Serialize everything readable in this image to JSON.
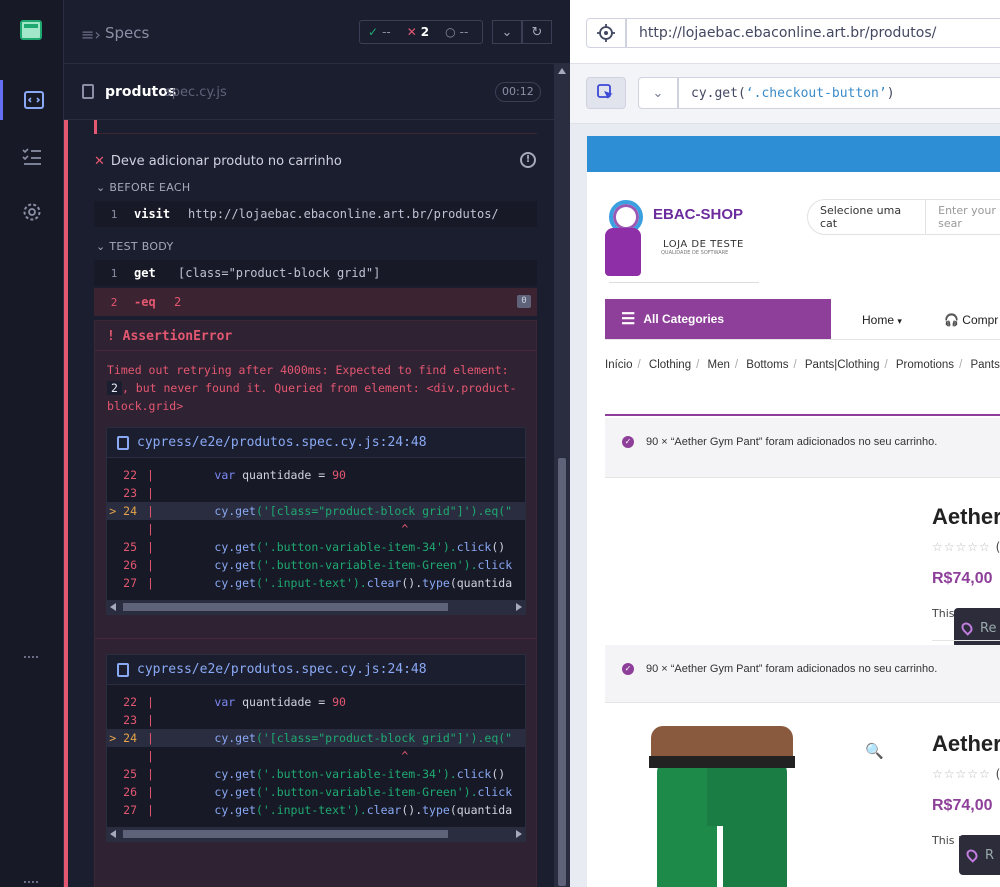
{
  "reporter": {
    "header": {
      "title": "Specs",
      "passed": "--",
      "failed": "2",
      "pending": "--"
    },
    "file": {
      "name": "produtos",
      "ext": "spec.cy.js",
      "duration": "00:12"
    },
    "test": {
      "title": "Deve adicionar produto no carrinho"
    },
    "before_each": {
      "label": "BEFORE EACH",
      "commands": [
        {
          "n": "1",
          "name": "visit",
          "message": "http://lojaebac.ebaconline.art.br/produtos/"
        }
      ]
    },
    "test_body": {
      "label": "TEST BODY",
      "commands": [
        {
          "n": "1",
          "name": "get",
          "message": "[class=\"product-block grid\"]"
        },
        {
          "n": "2",
          "name": "-eq",
          "message": "2",
          "badge": "0"
        }
      ]
    },
    "error": {
      "title": "AssertionError",
      "message_1": "Timed out retrying after 4000ms: Expected to find element:",
      "code": "2",
      "message_2": ", but never found it. Queried from element: <div.product-block.grid>"
    },
    "code_frame": {
      "file": "cypress/e2e/produtos.spec.cy.js:24:48",
      "lines": [
        {
          "n": "22",
          "marker": "",
          "kw": "var",
          "ident": " quantidade = ",
          "num": "90"
        },
        {
          "n": "23",
          "marker": ""
        },
        {
          "n": "24",
          "marker": ">",
          "call": "cy.get",
          "arg": "('[class=\"product-block grid\"]').eq(\""
        },
        {
          "n": "",
          "marker": "",
          "caret": "^"
        },
        {
          "n": "25",
          "marker": "",
          "call": "cy.get",
          "arg": "('.button-variable-item-34').",
          "fn": "click",
          "tail": "()"
        },
        {
          "n": "26",
          "marker": "",
          "call": "cy.get",
          "arg": "('.button-variable-item-Green').",
          "fn": "click"
        },
        {
          "n": "27",
          "marker": "",
          "call": "cy.get",
          "arg": "('.input-text').",
          "fn": "clear",
          "tail": "().",
          "fn2": "type",
          "tail2": "(quantida"
        }
      ]
    }
  },
  "aut": {
    "url": "http://lojaebac.ebaconline.art.br/produtos/",
    "selector_prefix": "cy.get(",
    "selector_value": "‘.checkout-button’",
    "selector_suffix": ")",
    "site": {
      "logo_text": "EBAC-SHOP",
      "logo_sub": "LOJA DE TESTE",
      "logo_sub2": "QUALIDADE DE SOFTWARE",
      "search_category": "Selecione uma cat",
      "search_placeholder": "Enter your sear",
      "all_categories": "All Categories",
      "nav_home": "Home",
      "nav_compare": "Compr",
      "breadcrumbs": [
        "Início",
        "Clothing",
        "Men",
        "Bottoms",
        "Pants|Clothing",
        "Promotions",
        "Pants|Clo"
      ],
      "notice": "90 × “Aether Gym Pant” foram adicionados no seu carrinho.",
      "product_title": "Aether",
      "rating_count": "(",
      "price": "R$74,00",
      "desc_1": "This",
      "desc_2": "This i",
      "chip_label": "Re",
      "chip_label_2": "R"
    }
  },
  "colors": {
    "accent": "#6470f3",
    "fail": "#e45770",
    "pass": "#1fa971",
    "brand": "#8e3f9a"
  }
}
